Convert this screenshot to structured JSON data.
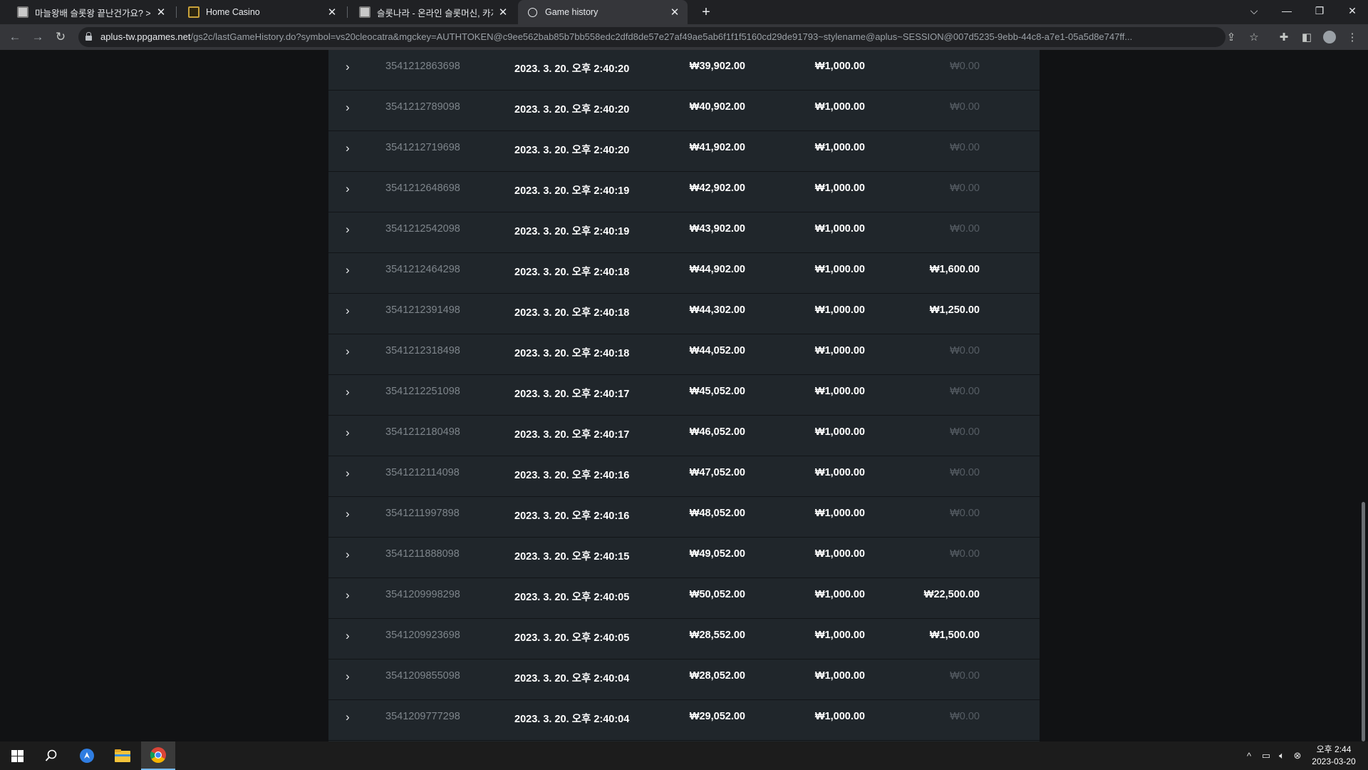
{
  "browser": {
    "tabs": [
      {
        "label": "마늘왕배 슬롯왕 끝난건가요? >",
        "active": false
      },
      {
        "label": "Home Casino",
        "active": false
      },
      {
        "label": "슬롯나라 - 온라인 슬롯머신, 카지노",
        "active": false
      },
      {
        "label": "Game history",
        "active": true
      }
    ],
    "url_host": "aplus-tw.ppgames.net",
    "url_path": "/gs2c/lastGameHistory.do?symbol=vs20cleocatra&mgckey=AUTHTOKEN@c9ee562bab85b7bb558edc2dfd8de57e27af49ae5ab6f1f1f5160cd29de91793~stylename@aplus~SESSION@007d5235-9ebb-44c8-a7e1-05a5d8e747ff..."
  },
  "history": {
    "rows": [
      {
        "id": "3541212863698",
        "date": "2023. 3. 20. 오후 2:40:20",
        "balance": "₩39,902.00",
        "bet": "₩1,000.00",
        "win": "₩0.00",
        "win_zero": true
      },
      {
        "id": "3541212789098",
        "date": "2023. 3. 20. 오후 2:40:20",
        "balance": "₩40,902.00",
        "bet": "₩1,000.00",
        "win": "₩0.00",
        "win_zero": true
      },
      {
        "id": "3541212719698",
        "date": "2023. 3. 20. 오후 2:40:20",
        "balance": "₩41,902.00",
        "bet": "₩1,000.00",
        "win": "₩0.00",
        "win_zero": true
      },
      {
        "id": "3541212648698",
        "date": "2023. 3. 20. 오후 2:40:19",
        "balance": "₩42,902.00",
        "bet": "₩1,000.00",
        "win": "₩0.00",
        "win_zero": true
      },
      {
        "id": "3541212542098",
        "date": "2023. 3. 20. 오후 2:40:19",
        "balance": "₩43,902.00",
        "bet": "₩1,000.00",
        "win": "₩0.00",
        "win_zero": true
      },
      {
        "id": "3541212464298",
        "date": "2023. 3. 20. 오후 2:40:18",
        "balance": "₩44,902.00",
        "bet": "₩1,000.00",
        "win": "₩1,600.00",
        "win_zero": false
      },
      {
        "id": "3541212391498",
        "date": "2023. 3. 20. 오후 2:40:18",
        "balance": "₩44,302.00",
        "bet": "₩1,000.00",
        "win": "₩1,250.00",
        "win_zero": false
      },
      {
        "id": "3541212318498",
        "date": "2023. 3. 20. 오후 2:40:18",
        "balance": "₩44,052.00",
        "bet": "₩1,000.00",
        "win": "₩0.00",
        "win_zero": true
      },
      {
        "id": "3541212251098",
        "date": "2023. 3. 20. 오후 2:40:17",
        "balance": "₩45,052.00",
        "bet": "₩1,000.00",
        "win": "₩0.00",
        "win_zero": true
      },
      {
        "id": "3541212180498",
        "date": "2023. 3. 20. 오후 2:40:17",
        "balance": "₩46,052.00",
        "bet": "₩1,000.00",
        "win": "₩0.00",
        "win_zero": true
      },
      {
        "id": "3541212114098",
        "date": "2023. 3. 20. 오후 2:40:16",
        "balance": "₩47,052.00",
        "bet": "₩1,000.00",
        "win": "₩0.00",
        "win_zero": true
      },
      {
        "id": "3541211997898",
        "date": "2023. 3. 20. 오후 2:40:16",
        "balance": "₩48,052.00",
        "bet": "₩1,000.00",
        "win": "₩0.00",
        "win_zero": true
      },
      {
        "id": "3541211888098",
        "date": "2023. 3. 20. 오후 2:40:15",
        "balance": "₩49,052.00",
        "bet": "₩1,000.00",
        "win": "₩0.00",
        "win_zero": true
      },
      {
        "id": "3541209998298",
        "date": "2023. 3. 20. 오후 2:40:05",
        "balance": "₩50,052.00",
        "bet": "₩1,000.00",
        "win": "₩22,500.00",
        "win_zero": false
      },
      {
        "id": "3541209923698",
        "date": "2023. 3. 20. 오후 2:40:05",
        "balance": "₩28,552.00",
        "bet": "₩1,000.00",
        "win": "₩1,500.00",
        "win_zero": false
      },
      {
        "id": "3541209855098",
        "date": "2023. 3. 20. 오후 2:40:04",
        "balance": "₩28,052.00",
        "bet": "₩1,000.00",
        "win": "₩0.00",
        "win_zero": true
      },
      {
        "id": "3541209777298",
        "date": "2023. 3. 20. 오후 2:40:04",
        "balance": "₩29,052.00",
        "bet": "₩1,000.00",
        "win": "₩0.00",
        "win_zero": true
      }
    ]
  },
  "taskbar": {
    "time": "오후 2:44",
    "date": "2023-03-20"
  }
}
